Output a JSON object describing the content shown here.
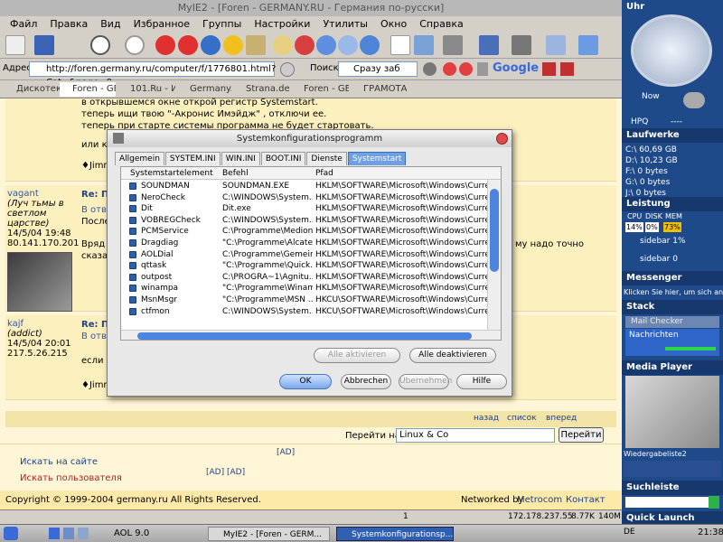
{
  "window": {
    "title": "MyIE2 - [Foren - GERMANY.RU - Германия по-русски]"
  },
  "menu": [
    "Файл",
    "Правка",
    "Вид",
    "Избранное",
    "Группы",
    "Настройки",
    "Утилиты",
    "Окно",
    "Справка"
  ],
  "address": {
    "label": "Адрес",
    "url": "http://foren.germany.ru/computer/f/1776801.html?Cat=&page=0",
    "search_label": "Поиск",
    "search_value": "Сразу заб",
    "google": "Google"
  },
  "tabs": [
    "Дискотек...",
    "Foren - GE...",
    "101.Ru - Инте...",
    "Germany.ru",
    "Strana.de Ima...",
    "Foren - GE...",
    "ГРАМОТА.РУ..."
  ],
  "forum": {
    "top_lines": [
      "в открывшемся окне открой регистр Systemstart.",
      "теперь ищи твою \"-Акронис Имэйдж\" , отключи ее.",
      "теперь при старте системы программа не будет стартовать."
    ],
    "top_line4": "или ко",
    "top_sign": "♦Jimm",
    "post1": {
      "user": "vagant",
      "tagline": "(Луч тьмы в светлом царстве)",
      "date": "14/5/04 19:48",
      "ip": "80.141.170.201",
      "title": "Re: П",
      "reply": "В отве",
      "text1": "После",
      "text2": "Вряд л",
      "text3": "сказат",
      "right": "му надо точно"
    },
    "post2": {
      "user": "kajf",
      "tagline": "(addict)",
      "date": "14/5/04 20:01",
      "ip": "217.5.26.215",
      "title": "Re: П",
      "reply": "В отве",
      "text1": "если н",
      "sign": "♦Jimm"
    },
    "nav": {
      "back": "назад",
      "list": "список",
      "forward": "вперед"
    },
    "goto_label": "Перейти на",
    "goto_value": "Linux & Co",
    "goto_button": "Перейти",
    "search_site": "Искать на сайте",
    "search_user": "Искать пользователя",
    "ad": "[AD]",
    "ad2": "[AD] [AD]",
    "copyright": "Copyright © 1999-2004 germany.ru All Rights Reserved.",
    "network": "Networked by",
    "network_link": "Metrocom",
    "contact": "Контакт"
  },
  "dialog": {
    "title": "Systemkonfigurationsprogramm",
    "tabs": [
      "Allgemein",
      "SYSTEM.INI",
      "WIN.INI",
      "BOOT.INI",
      "Dienste",
      "Systemstart"
    ],
    "columns": [
      "Systemstartelement",
      "Befehl",
      "Pfad"
    ],
    "rows": [
      {
        "name": "SOUNDMAN",
        "cmd": "SOUNDMAN.EXE",
        "path": "HKLM\\SOFTWARE\\Microsoft\\Windows\\CurrentVer..."
      },
      {
        "name": "NeroCheck",
        "cmd": "C:\\WINDOWS\\System...",
        "path": "HKLM\\SOFTWARE\\Microsoft\\Windows\\CurrentVer..."
      },
      {
        "name": "Dit",
        "cmd": "Dit.exe",
        "path": "HKLM\\SOFTWARE\\Microsoft\\Windows\\CurrentVer..."
      },
      {
        "name": "VOBREGCheck",
        "cmd": "C:\\WINDOWS\\System...",
        "path": "HKLM\\SOFTWARE\\Microsoft\\Windows\\CurrentVer..."
      },
      {
        "name": "PCMService",
        "cmd": "C:\\Programme\\Medion...",
        "path": "HKLM\\SOFTWARE\\Microsoft\\Windows\\CurrentVer..."
      },
      {
        "name": "Dragdiag",
        "cmd": "\"C:\\Programme\\Alcate...",
        "path": "HKLM\\SOFTWARE\\Microsoft\\Windows\\CurrentVer..."
      },
      {
        "name": "AOLDial",
        "cmd": "C:\\Programme\\Gemein...",
        "path": "HKLM\\SOFTWARE\\Microsoft\\Windows\\CurrentVer..."
      },
      {
        "name": "qttask",
        "cmd": "\"C:\\Programme\\Quick...",
        "path": "HKLM\\SOFTWARE\\Microsoft\\Windows\\CurrentVer..."
      },
      {
        "name": "outpost",
        "cmd": "C:\\PROGRA~1\\Agnitu...",
        "path": "HKLM\\SOFTWARE\\Microsoft\\Windows\\CurrentVer..."
      },
      {
        "name": "winampa",
        "cmd": "\"C:\\Programme\\Winam...",
        "path": "HKLM\\SOFTWARE\\Microsoft\\Windows\\CurrentVer..."
      },
      {
        "name": "MsnMsgr",
        "cmd": "\"C:\\Programme\\MSN ...",
        "path": "HKCU\\SOFTWARE\\Microsoft\\Windows\\CurrentVer..."
      },
      {
        "name": "ctfmon",
        "cmd": "C:\\WINDOWS\\System...",
        "path": "HKCU\\SOFTWARE\\Microsoft\\Windows\\CurrentVer..."
      }
    ],
    "enable_all": "Alle aktivieren",
    "disable_all": "Alle deaktivieren",
    "ok": "OK",
    "cancel": "Abbrechen",
    "apply": "Übernehmen",
    "help": "Hilfe"
  },
  "statusbar": {
    "count": "1",
    "ip": "172.178.237.55",
    "speed": "8.77K",
    "mem": "140M"
  },
  "taskbar": {
    "aol": "AOL 9.0",
    "task1": "MyIE2 - [Foren - GERM...",
    "task2": "Systemkonfigurationsp...",
    "lang": "DE",
    "time": "21:38"
  },
  "sidebar": {
    "clock": "Uhr",
    "now": "Now",
    "hpq": "HPQ",
    "hpq_val": "----",
    "drives_title": "Laufwerke",
    "drives": [
      "C:\\ 60,69 GB",
      "D:\\ 10,23 GB",
      "F:\\ 0 bytes",
      "G:\\ 0 bytes",
      "J:\\ 0 bytes"
    ],
    "perf_title": "Leistung",
    "cpu": "CPU",
    "disk": "DISK",
    "mem": "MEM",
    "cpu_v": "14%",
    "disk_v": "0%",
    "mem_v": "73%",
    "sb1": "sidebar 1%",
    "sb0": "sidebar 0",
    "messenger": "Messenger",
    "messenger_text": "Klicken Sie hier, um sich anz",
    "stack": "Stack",
    "mail": "Mail Checker",
    "news": "Nachrichten",
    "media": "Media Player",
    "playlist": "Wiedergabeliste2",
    "search": "Suchleiste",
    "quick": "Quick Launch"
  }
}
